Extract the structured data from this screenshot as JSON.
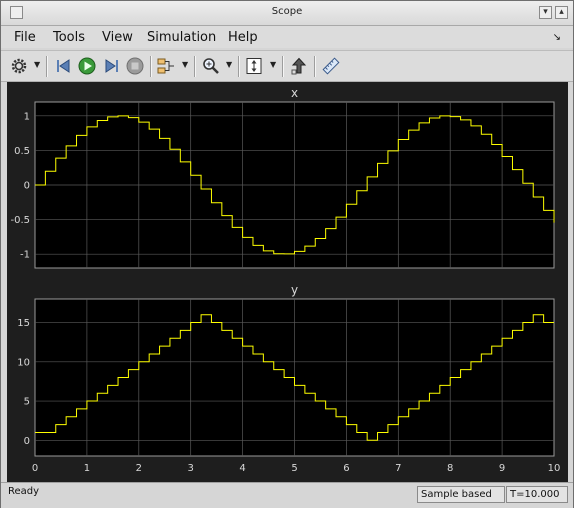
{
  "window": {
    "title": "Scope"
  },
  "menu": {
    "items": [
      "File",
      "Tools",
      "View",
      "Simulation",
      "Help"
    ]
  },
  "toolbar": {
    "icons": [
      "gear-icon",
      "step-back-icon",
      "run-icon",
      "step-forward-icon",
      "stop-icon",
      "signal-select-icon",
      "zoom-icon",
      "scale-axes-icon",
      "highlight-block-icon",
      "measure-icon"
    ]
  },
  "status": {
    "text": "Ready",
    "mode": "Sample based",
    "time": "T=10.000"
  },
  "colors": {
    "trace": "#ffff00",
    "axes_bg": "#000000",
    "panel_bg": "#1e1e1e",
    "grid": "#5a5a5a",
    "text": "#d8d8d8"
  },
  "chart_data": [
    {
      "type": "line",
      "title": "x",
      "x_ticks": [
        "0",
        "1",
        "2",
        "3",
        "4",
        "5",
        "6",
        "7",
        "8",
        "9",
        "10"
      ],
      "y_ticks": [
        "1",
        "0.5",
        "0",
        "-0.5",
        "-1"
      ],
      "xlim": [
        0,
        10
      ],
      "ylim": [
        -1.2,
        1.2
      ],
      "grid": true,
      "series": [
        {
          "step": true,
          "x": [
            0,
            0.2,
            0.4,
            0.6,
            0.8,
            1,
            1.2,
            1.4,
            1.6,
            1.8,
            2,
            2.2,
            2.4,
            2.6,
            2.8,
            3,
            3.2,
            3.4,
            3.6,
            3.8,
            4,
            4.2,
            4.4,
            4.6,
            4.8,
            5,
            5.2,
            5.4,
            5.6,
            5.8,
            6,
            6.2,
            6.4,
            6.6,
            6.8,
            7,
            7.2,
            7.4,
            7.6,
            7.8,
            8,
            8.2,
            8.4,
            8.6,
            8.8,
            9,
            9.2,
            9.4,
            9.6,
            9.8,
            10
          ],
          "values": [
            0,
            0.199,
            0.389,
            0.565,
            0.717,
            0.841,
            0.932,
            0.985,
            1,
            0.974,
            0.909,
            0.808,
            0.675,
            0.516,
            0.335,
            0.141,
            -0.058,
            -0.256,
            -0.443,
            -0.612,
            -0.757,
            -0.872,
            -0.952,
            -0.994,
            -0.996,
            -0.959,
            -0.883,
            -0.773,
            -0.631,
            -0.465,
            -0.279,
            -0.083,
            0.117,
            0.312,
            0.494,
            0.657,
            0.794,
            0.899,
            0.968,
            0.999,
            0.989,
            0.941,
            0.855,
            0.734,
            0.585,
            0.412,
            0.223,
            0.025,
            -0.174,
            -0.366,
            -0.544
          ]
        }
      ]
    },
    {
      "type": "line",
      "title": "y",
      "x_ticks": [
        "0",
        "1",
        "2",
        "3",
        "4",
        "5",
        "6",
        "7",
        "8",
        "9",
        "10"
      ],
      "y_ticks": [
        "15",
        "10",
        "5",
        "0"
      ],
      "xlim": [
        0,
        10
      ],
      "ylim": [
        -2,
        18
      ],
      "grid": true,
      "series": [
        {
          "step": true,
          "x": [
            0,
            0.2,
            0.4,
            0.6,
            0.8,
            1,
            1.2,
            1.4,
            1.6,
            1.8,
            2,
            2.2,
            2.4,
            2.6,
            2.8,
            3,
            3.2,
            3.4,
            3.6,
            3.8,
            4,
            4.2,
            4.4,
            4.6,
            4.8,
            5,
            5.2,
            5.4,
            5.6,
            5.8,
            6,
            6.2,
            6.4,
            6.6,
            6.8,
            7,
            7.2,
            7.4,
            7.6,
            7.8,
            8,
            8.2,
            8.4,
            8.6,
            8.8,
            9,
            9.2,
            9.4,
            9.6,
            9.8,
            10
          ],
          "values": [
            1,
            1,
            2,
            3,
            4,
            5,
            6,
            7,
            8,
            9,
            10,
            11,
            12,
            13,
            14,
            15,
            16,
            15,
            14,
            13,
            12,
            11,
            10,
            9,
            8,
            7,
            6,
            5,
            4,
            3,
            2,
            1,
            0,
            1,
            2,
            3,
            4,
            5,
            6,
            7,
            8,
            9,
            10,
            11,
            12,
            13,
            14,
            15,
            16,
            15,
            15
          ]
        }
      ]
    }
  ]
}
